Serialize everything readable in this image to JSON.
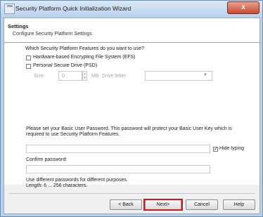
{
  "window": {
    "title": "Security Platform Quick Initialization Wizard",
    "icon_text": "TPM",
    "close_symbol": "x"
  },
  "header": {
    "title": "Settings",
    "subtitle": "Configure Security Platform Settings"
  },
  "features": {
    "question": "Which Security Platform Features do you want to use?",
    "efs_label": "Hardware-based Encrypting File System (EFS)",
    "efs_checked": false,
    "psd_label": "Personal Secure Drive (PSD)",
    "psd_checked": false,
    "size_label": "Size:",
    "size_value": "0",
    "size_unit": "MB",
    "drive_label": "Drive letter",
    "drive_value": ""
  },
  "password": {
    "instruction": "Please set your Basic User Password. This password will protect your Basic User Key which is required to use Security Platform Features.",
    "password_value": "",
    "hide_typing_label": "Hide typing",
    "hide_typing_checked": true,
    "confirm_label": "Confirm password:",
    "confirm_value": "",
    "note_line1": "Use different passwords for different purposes.",
    "note_line2": "Length: 6 ... 256 characters."
  },
  "buttons": {
    "back": "< Back",
    "next": "Next>",
    "cancel": "Cancel",
    "help": "Help"
  },
  "colors": {
    "highlight": "#d01a1a",
    "title_gradient_top": "#dbe8f6",
    "close_button": "#c94a34"
  }
}
